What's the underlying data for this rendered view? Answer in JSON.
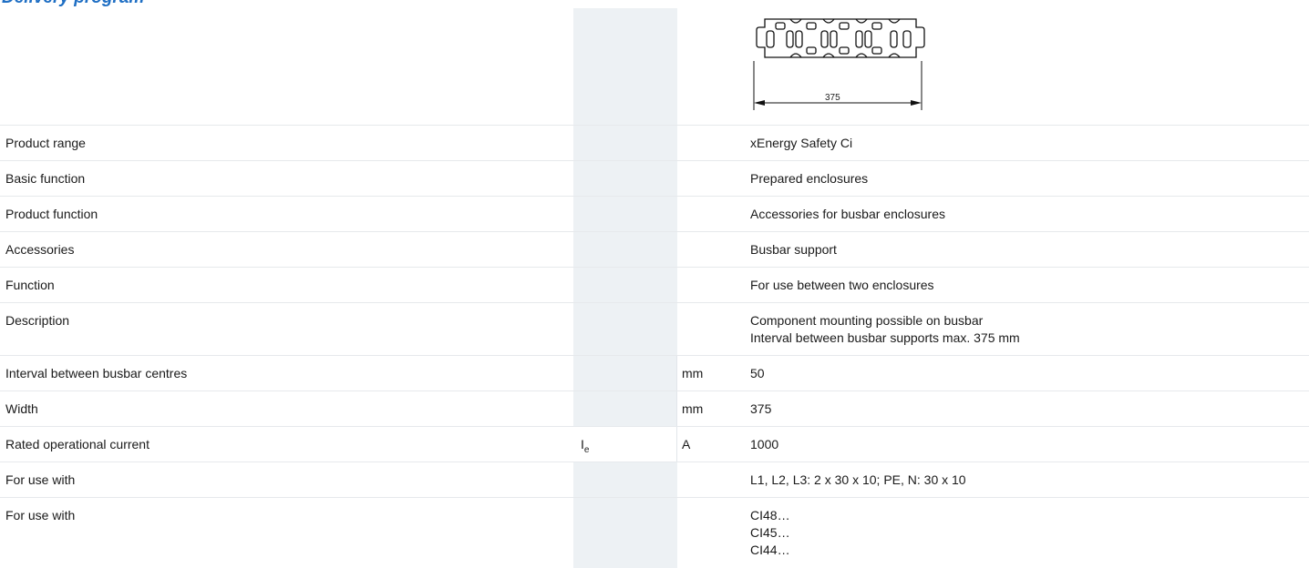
{
  "heading": "Delivery program",
  "drawing": {
    "dimension_label": "375"
  },
  "rows": [
    {
      "label": "Product range",
      "symbol": "",
      "unit": "",
      "value": [
        "xEnergy Safety Ci"
      ]
    },
    {
      "label": "Basic function",
      "symbol": "",
      "unit": "",
      "value": [
        "Prepared enclosures"
      ]
    },
    {
      "label": "Product function",
      "symbol": "",
      "unit": "",
      "value": [
        "Accessories for busbar enclosures"
      ]
    },
    {
      "label": "Accessories",
      "symbol": "",
      "unit": "",
      "value": [
        "Busbar support"
      ]
    },
    {
      "label": "Function",
      "symbol": "",
      "unit": "",
      "value": [
        "For use between two enclosures"
      ]
    },
    {
      "label": "Description",
      "symbol": "",
      "unit": "",
      "value": [
        "Component mounting possible on busbar",
        "Interval between busbar supports max. 375 mm"
      ]
    },
    {
      "label": "Interval between busbar centres",
      "symbol": "",
      "unit": "mm",
      "value": [
        "50"
      ]
    },
    {
      "label": "Width",
      "symbol": "",
      "unit": "mm",
      "value": [
        "375"
      ]
    },
    {
      "label": "Rated operational current",
      "symbol": "I",
      "symbol_sub": "e",
      "unit": "A",
      "value": [
        "1000"
      ]
    },
    {
      "label": "For use with",
      "symbol": "",
      "unit": "",
      "value": [
        "L1, L2, L3: 2 x 30 x 10; PE, N: 30 x 10"
      ]
    },
    {
      "label": "For use with",
      "symbol": "",
      "unit": "",
      "value": [
        "CI48…",
        "CI45…",
        "CI44…"
      ]
    }
  ]
}
